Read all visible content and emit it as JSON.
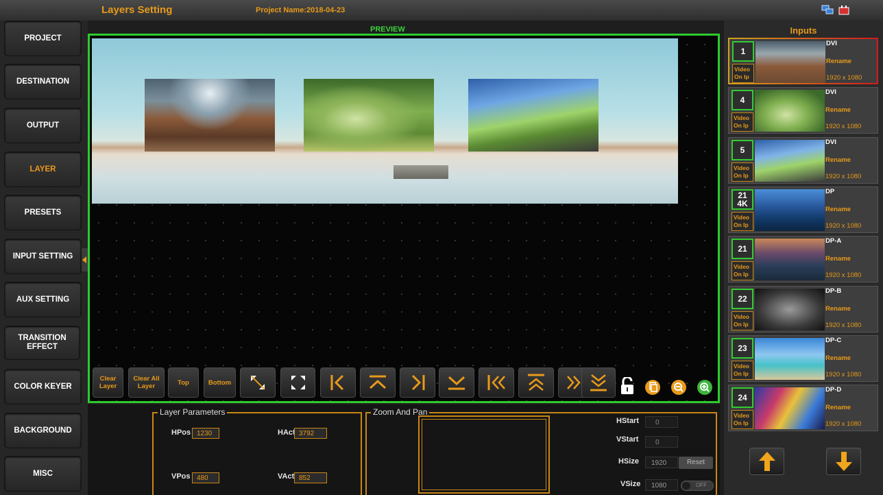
{
  "header": {
    "title": "Layers Setting",
    "project_name": "Project Name:2018-04-23",
    "icons": [
      "network-icon",
      "plug-icon"
    ]
  },
  "nav": {
    "items": [
      {
        "label": "PROJECT"
      },
      {
        "label": "DESTINATION"
      },
      {
        "label": "OUTPUT"
      },
      {
        "label": "LAYER",
        "active": true
      },
      {
        "label": "PRESETS"
      },
      {
        "label": "INPUT SETTING"
      },
      {
        "label": "AUX SETTING"
      },
      {
        "label": "TRANSITION EFFECT"
      },
      {
        "label": "COLOR KEYER"
      },
      {
        "label": "BACKGROUND"
      },
      {
        "label": "MISC"
      }
    ]
  },
  "preview": {
    "label": "PREVIEW"
  },
  "toolbar": {
    "clear_layer": "Clear Layer",
    "clear_all_layer": "Clear All Layer",
    "top": "Top",
    "bottom": "Bottom",
    "icons": [
      "resize-diagonal-icon",
      "fullscreen-icon",
      "move-left-edge-icon",
      "move-top-edge-icon",
      "move-right-edge-icon",
      "move-bottom-edge-icon",
      "move-far-left-icon",
      "move-far-top-icon",
      "move-far-right-icon",
      "move-far-bottom-icon",
      "unlock-icon",
      "copy-icon",
      "zoom-out-icon",
      "zoom-in-icon"
    ]
  },
  "layer_params": {
    "legend": "Layer Parameters",
    "hpos_label": "HPos",
    "hpos": "1230",
    "hact_label": "HAct",
    "hact": "3792",
    "vpos_label": "VPos",
    "vpos": "480",
    "vact_label": "VAct",
    "vact": "852"
  },
  "zoom_pan": {
    "legend": "Zoom And Pan",
    "hstart_label": "HStart",
    "hstart": "0",
    "vstart_label": "VStart",
    "vstart": "0",
    "hsize_label": "HSize",
    "hsize": "1920",
    "vsize_label": "VSize",
    "vsize": "1080",
    "reset": "Reset",
    "toggle": "OFF"
  },
  "inputs": {
    "title": "Inputs",
    "video_label": "Video On Ip",
    "rename": "Rename",
    "cards": [
      {
        "num": "1",
        "type": "DVI",
        "res": "1920 x 1080",
        "selected": true
      },
      {
        "num": "4",
        "type": "DVI",
        "res": "1920 x 1080"
      },
      {
        "num": "5",
        "type": "DVI",
        "res": "1920 x 1080"
      },
      {
        "num": "21 4K",
        "type": "DP",
        "res": "1920 x 1080"
      },
      {
        "num": "21",
        "type": "DP-A",
        "res": "1920 x 1080"
      },
      {
        "num": "22",
        "type": "DP-B",
        "res": "1920 x 1080"
      },
      {
        "num": "23",
        "type": "DP-C",
        "res": "1920 x 1080"
      },
      {
        "num": "24",
        "type": "DP-D",
        "res": "1920 x 1080"
      }
    ],
    "scroll_icons": [
      "arrow-up-icon",
      "arrow-down-icon"
    ]
  },
  "colors": {
    "accent": "#e89a1a",
    "preview_border": "#2ccc2c",
    "background": "#1e1e1e"
  }
}
